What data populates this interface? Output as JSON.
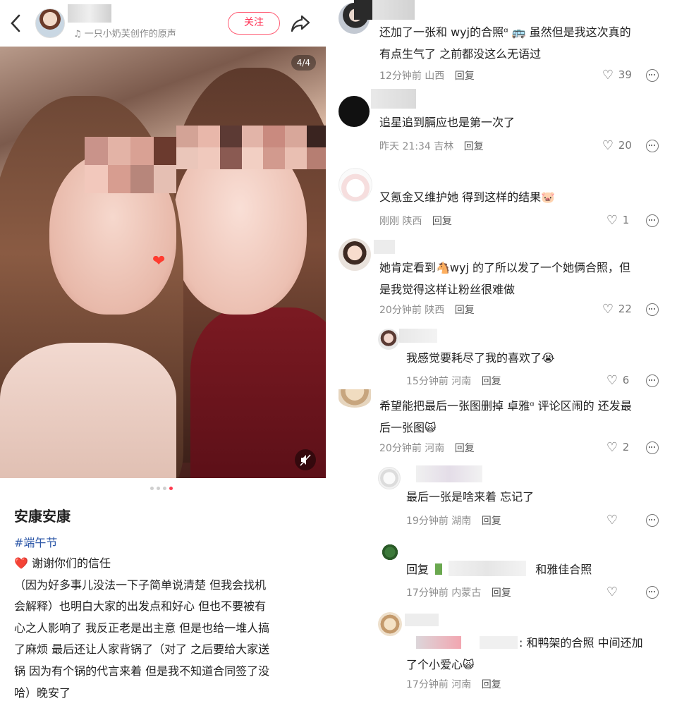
{
  "post": {
    "music": "♫ 一只小奶芙创作的原声",
    "follow_label": "关注",
    "pager": "4/4",
    "title": "安康安康",
    "tag": "#端午节",
    "body_lines": [
      "❤️ 谢谢你们的信任",
      "（因为好多事儿没法一下子简单说清楚 但我会找机",
      "会解释）也明白大家的出发点和好心 但也不要被有",
      "心之人影响了 我反正老是出主意 但是也给一堆人搞",
      "了麻烦 最后还让人家背锅了（对了 之后要给大家送",
      "锅 因为有个锅的代言来着 但是我不知道合同签了没",
      "哈）晚安了"
    ]
  },
  "comments": [
    {
      "text_lines": [
        "还加了一张和 wyj的合照ᵅ 🚌 虽然但是我这次真的",
        "有点生气了 之前都没这么无语过"
      ],
      "time": "12分钟前",
      "region": "山西",
      "reply": "回复",
      "likes": "39"
    },
    {
      "text_lines": [
        "追星追到膈应也是第一次了"
      ],
      "time": "昨天 21:34",
      "region": "吉林",
      "reply": "回复",
      "likes": "20"
    },
    {
      "text_lines": [
        "又氪金又维护她 得到这样的结果🐷"
      ],
      "time": "刚刚",
      "region": "陕西",
      "reply": "回复",
      "likes": "1"
    },
    {
      "text_lines": [
        "她肯定看到🐴wyj 的了所以发了一个她俩合照，但",
        "是我觉得这样让粉丝很难做"
      ],
      "time": "20分钟前",
      "region": "陕西",
      "reply": "回复",
      "likes": "22"
    },
    {
      "text_lines": [
        "我感觉要耗尽了我的喜欢了😭"
      ],
      "time": "15分钟前",
      "region": "河南",
      "reply": "回复",
      "likes": "6"
    },
    {
      "text_lines": [
        "希望能把最后一张图删掉 卓雅ᵅ 评论区闹的 还发最",
        "后一张图🙀"
      ],
      "time": "20分钟前",
      "region": "河南",
      "reply": "回复",
      "likes": "2"
    },
    {
      "text_lines": [
        "最后一张是啥来着 忘记了"
      ],
      "time": "19分钟前",
      "region": "湖南",
      "reply": "回复",
      "likes": ""
    },
    {
      "reply_prefix": "回复",
      "text_lines": [
        "和雅佳合照"
      ],
      "time": "17分钟前",
      "region": "内蒙古",
      "reply": "回复",
      "likes": ""
    },
    {
      "text_lines": [
        ": 和鸭架的合照 中间还加",
        "了个小爱心🙀"
      ],
      "time": "17分钟前",
      "region": "河南",
      "reply": "回复",
      "likes": ""
    }
  ]
}
